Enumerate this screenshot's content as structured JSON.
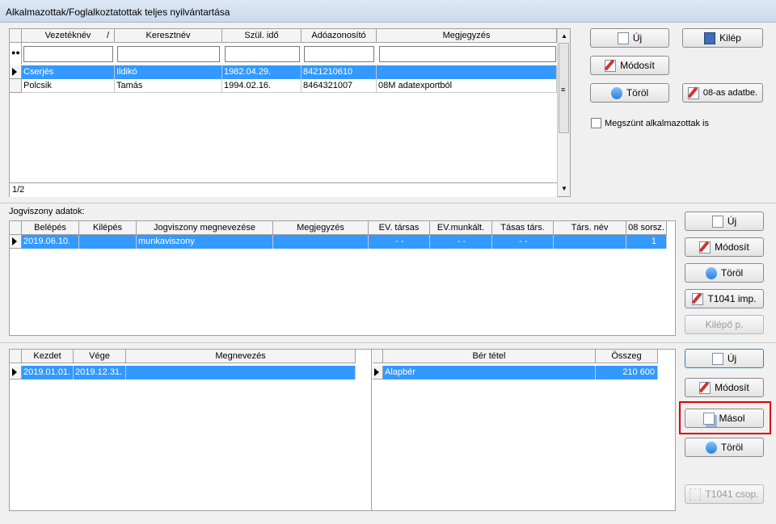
{
  "window": {
    "title": "Alkalmazottak/Foglalkoztatottak teljes nyilvántartása"
  },
  "employees": {
    "columns": [
      "Vezetéknév",
      "Keresztnév",
      "Szül. idő",
      "Adóazonosító",
      "Megjegyzés"
    ],
    "sort_indicator": "/",
    "rows": [
      [
        "Cserjés",
        "Ildikó",
        "1982.04.29.",
        "8421210610",
        ""
      ],
      [
        "Polcsik",
        "Tamás",
        "1994.02.16.",
        "8464321007",
        "08M adatexportból"
      ]
    ],
    "record_counter": "1/2",
    "buttons": {
      "new": "Új",
      "exit": "Kilép",
      "edit": "Módosít",
      "delete": "Töröl",
      "import08": "08-as adatbe."
    },
    "checkbox_label": "Megszünt alkalmazottak is"
  },
  "employment": {
    "section_label": "Jogviszony adatok:",
    "columns": [
      "Belépés",
      "Kilépés",
      "Jogviszony megnevezése",
      "Megjegyzés",
      "EV. társas",
      "EV.munkált.",
      "Tásas társ.",
      "Társ. név",
      "08 sorsz."
    ],
    "rows": [
      [
        "2019.06.10.",
        "",
        "munkaviszony",
        "",
        "- -",
        "- -",
        "- -",
        "",
        "1"
      ]
    ],
    "buttons": {
      "new": "Új",
      "edit": "Módosít",
      "delete": "Töröl",
      "t1041": "T1041 imp.",
      "leaving": "Kilépő p."
    }
  },
  "periods": {
    "columns": [
      "Kezdet",
      "Vége",
      "Megnevezés"
    ],
    "rows": [
      [
        "2019.01.01.",
        "2019.12.31.",
        ""
      ]
    ]
  },
  "wages": {
    "columns": [
      "Bér tétel",
      "Összeg"
    ],
    "rows": [
      [
        "Alapbér",
        "210 600"
      ]
    ]
  },
  "bottom_buttons": {
    "new": "Új",
    "edit": "Módosít",
    "copy": "Másol",
    "delete": "Töröl",
    "t1041group": "T1041 csop."
  },
  "colors": {
    "selection": "#3399ff",
    "highlight": "#e00000"
  }
}
